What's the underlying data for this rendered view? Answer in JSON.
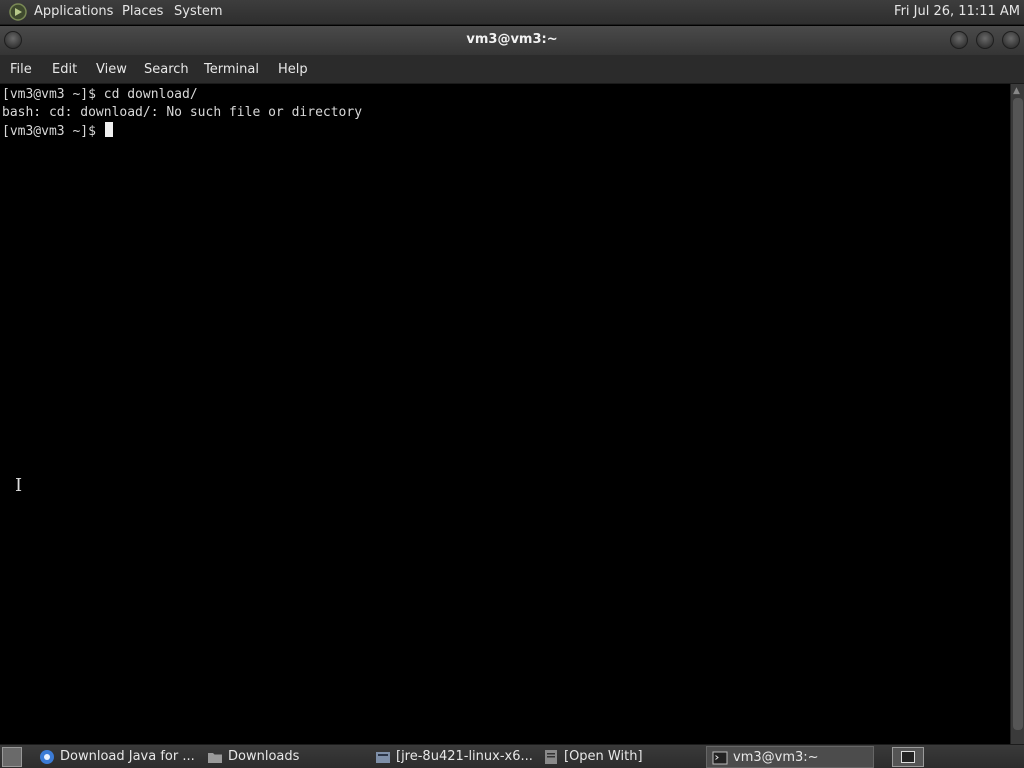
{
  "top_panel": {
    "menus": [
      "Applications",
      "Places",
      "System"
    ],
    "clock": "Fri Jul 26, 11:11 AM"
  },
  "window": {
    "title": "vm3@vm3:~"
  },
  "menubar": [
    "File",
    "Edit",
    "View",
    "Search",
    "Terminal",
    "Help"
  ],
  "terminal": {
    "lines": [
      "[vm3@vm3 ~]$ cd download/",
      "bash: cd: download/: No such file or directory",
      "[vm3@vm3 ~]$ "
    ]
  },
  "taskbar": {
    "tasks": [
      {
        "label": "Download Java for ...",
        "icon": "browser-icon"
      },
      {
        "label": "Downloads",
        "icon": "folder-icon"
      },
      {
        "label": "[jre-8u421-linux-x6...",
        "icon": "archive-icon"
      },
      {
        "label": "[Open With]",
        "icon": "dialog-icon"
      },
      {
        "label": "vm3@vm3:~",
        "icon": "terminal-icon"
      }
    ]
  },
  "colors": {
    "panel": "#333333",
    "terminal_bg": "#000000",
    "terminal_fg": "#d8d8d8"
  }
}
